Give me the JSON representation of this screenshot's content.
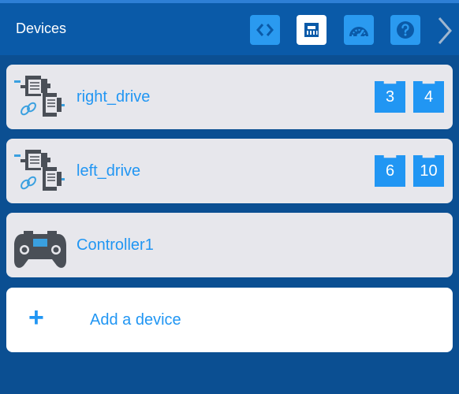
{
  "header": {
    "title": "Devices",
    "buttons": [
      {
        "name": "code-icon",
        "active": false
      },
      {
        "name": "ethernet-port-icon",
        "active": true
      },
      {
        "name": "dashboard-gauge-icon",
        "active": false
      },
      {
        "name": "help-icon",
        "active": false
      }
    ],
    "next_icon": "chevron-right-icon"
  },
  "devices": [
    {
      "label": "right_drive",
      "icon": "drivetrain-icon",
      "ports": [
        "3",
        "4"
      ]
    },
    {
      "label": "left_drive",
      "icon": "drivetrain-icon",
      "ports": [
        "6",
        "10"
      ]
    },
    {
      "label": "Controller1",
      "icon": "controller-icon",
      "ports": []
    }
  ],
  "add_device": {
    "label": "Add a device",
    "icon": "plus-icon",
    "icon_glyph": "+"
  },
  "colors": {
    "background": "#0b4f92",
    "header": "#0a5aa8",
    "accent": "#2196f3",
    "card": "#e7e7ec"
  }
}
